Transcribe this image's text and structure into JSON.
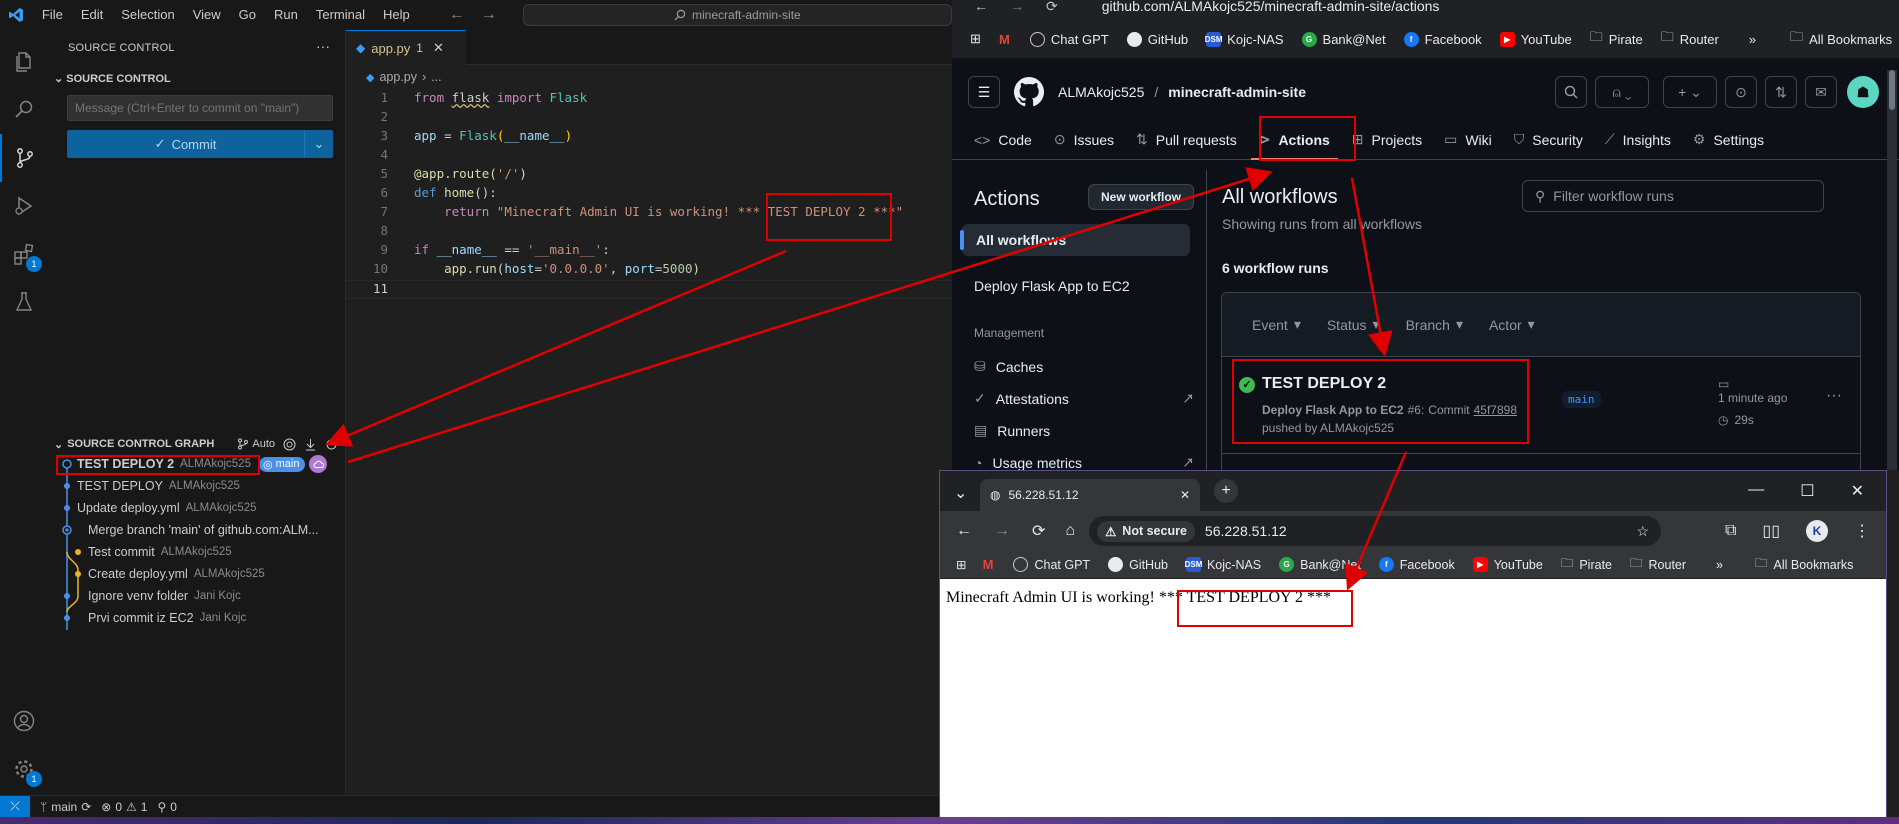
{
  "vscode": {
    "menu": [
      "File",
      "Edit",
      "Selection",
      "View",
      "Go",
      "Run",
      "Terminal",
      "Help"
    ],
    "search_text": "minecraft-admin-site",
    "sidebar": {
      "title": "SOURCE CONTROL",
      "section": "SOURCE CONTROL",
      "commit_placeholder": "Message (Ctrl+Enter to commit on \"main\")",
      "commit_label": "Commit",
      "graph_title": "SOURCE CONTROL GRAPH",
      "graph_auto": "Auto",
      "graph": [
        {
          "message": "TEST DEPLOY 2",
          "author": "ALMAkojc525"
        },
        {
          "message": "TEST DEPLOY",
          "author": "ALMAkojc525"
        },
        {
          "message": "Update deploy.yml",
          "author": "ALMAkojc525"
        },
        {
          "message": "Merge branch 'main' of github.com:ALM...",
          "author": ""
        },
        {
          "message": "Test commit",
          "author": "ALMAkojc525"
        },
        {
          "message": "Create deploy.yml",
          "author": "ALMAkojc525"
        },
        {
          "message": "Ignore venv folder",
          "author": "Jani Kojc"
        },
        {
          "message": "Prvi commit iz EC2",
          "author": "Jani Kojc"
        }
      ],
      "branch_badge": "main"
    },
    "activity_badge": "1",
    "settings_badge": "1",
    "tab": {
      "name": "app.py",
      "modified": "1"
    },
    "breadcrumb": [
      "app.py",
      "..."
    ],
    "line_numbers": [
      "1",
      "2",
      "3",
      "4",
      "5",
      "6",
      "7",
      "8",
      "9",
      "10",
      "11"
    ],
    "code": {
      "l1": [
        "from",
        "flask",
        "import",
        "Flask"
      ],
      "l3": [
        "app",
        "=",
        "Flask",
        "(",
        "__name__",
        ")"
      ],
      "l5": [
        "@app.route(",
        "'/'",
        ")"
      ],
      "l6": [
        "def",
        "home",
        "():"
      ],
      "l7": [
        "return",
        "\"Minecraft Admin UI is working! *** TEST DEPLOY 2 ***\""
      ],
      "l9": [
        "if",
        "__name__",
        "==",
        "'__main__'",
        ":"
      ],
      "l10": [
        "app.run(",
        "host",
        "=",
        "'0.0.0.0'",
        ", ",
        "port",
        "=",
        "5000",
        ")"
      ]
    },
    "status": {
      "branch": "main",
      "errors": "0",
      "warnings": "1",
      "ports": "0"
    }
  },
  "github": {
    "url": "github.com/ALMAkojc525/minecraft-admin-site/actions",
    "bookmarks": [
      "Chat GPT",
      "GitHub",
      "Kojc-NAS",
      "Bank@Net",
      "Facebook",
      "YouTube",
      "Pirate",
      "Router"
    ],
    "all_bookmarks": "All Bookmarks",
    "owner": "ALMAkojc525",
    "separator": "/",
    "repo": "minecraft-admin-site",
    "nav": [
      "Code",
      "Issues",
      "Pull requests",
      "Actions",
      "Projects",
      "Wiki",
      "Security",
      "Insights",
      "Settings"
    ],
    "side": {
      "title": "Actions",
      "new_workflow": "New workflow",
      "all_workflows": "All workflows",
      "workflow": "Deploy Flask App to EC2",
      "management": "Management",
      "items": [
        "Caches",
        "Attestations",
        "Runners",
        "Usage metrics"
      ]
    },
    "main": {
      "title": "All workflows",
      "subtitle": "Showing runs from all workflows",
      "filter_placeholder": "Filter workflow runs",
      "runs_count": "6 workflow runs",
      "filters": [
        "Event",
        "Status",
        "Branch",
        "Actor"
      ],
      "run": {
        "title": "TEST DEPLOY 2",
        "workflow": "Deploy Flask App to EC2",
        "number": "#6:",
        "commit_label": "Commit",
        "commit": "45f7898",
        "pushed_by": "pushed by ALMAkojc525",
        "branch": "main",
        "time": "1 minute ago",
        "duration": "29s"
      }
    }
  },
  "browser": {
    "tab_title": "56.228.51.12",
    "not_secure": "Not secure",
    "address": "56.228.51.12",
    "bookmarks": [
      "Chat GPT",
      "GitHub",
      "Kojc-NAS",
      "Bank@Net",
      "Facebook",
      "YouTube",
      "Pirate",
      "Router"
    ],
    "all_bookmarks": "All Bookmarks",
    "page_text": "Minecraft Admin UI is working! *** TEST DEPLOY 2 ***",
    "profile_letter": "K"
  },
  "colors": {
    "accent": "#0078d4",
    "annotation": "#e00000",
    "success": "#3fb950",
    "github_bg": "#0d1117"
  }
}
